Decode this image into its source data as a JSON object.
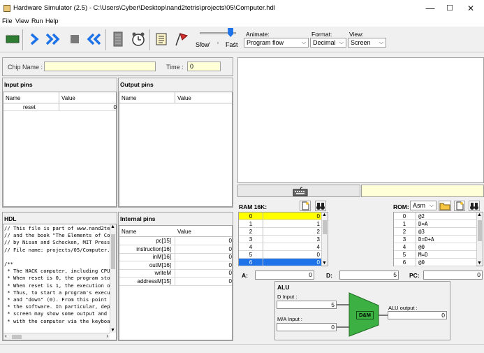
{
  "window": {
    "title": "Hardware Simulator (2.5) - C:\\Users\\Cyber\\Desktop\\nand2tetris\\projects\\05\\Computer.hdl",
    "minimize": "—",
    "maximize": "☐",
    "close": "✕"
  },
  "menu": [
    "File",
    "View",
    "Run",
    "Help"
  ],
  "toolbar": {
    "speed_slow": "Slow",
    "speed_fast": "Fast",
    "speed_level": 0.85,
    "animate_label": "Animate:",
    "animate_value": "Program flow",
    "format_label": "Format:",
    "format_value": "Decimal",
    "view_label": "View:",
    "view_value": "Screen",
    "icons": [
      "load-chip-icon",
      "single-step-icon",
      "run-icon",
      "stop-icon",
      "reset-icon",
      "eval-icon",
      "clock-icon",
      "script-icon",
      "breakpoint-icon"
    ]
  },
  "chip": {
    "name_label": "Chip Name :",
    "name_value": "",
    "time_label": "Time :",
    "time_value": "0"
  },
  "input_pins": {
    "title": "Input pins",
    "headers": [
      "Name",
      "Value"
    ],
    "rows": [
      {
        "name": "reset",
        "value": "0"
      }
    ]
  },
  "output_pins": {
    "title": "Output pins",
    "headers": [
      "Name",
      "Value"
    ]
  },
  "hdl": {
    "title": "HDL",
    "lines": [
      "// This file is part of www.nand2tetr",
      "// and the book \"The Elements of Comp",
      "// by Nisan and Schocken, MIT Press.",
      "// File name: projects/05/Computer.hd",
      "",
      "/**",
      " * The HACK computer, including CPU, ",
      " * When reset is 0, the program store",
      " * When reset is 1, the execution of ",
      " * Thus, to start a program's executi",
      " * and \"down\" (0). From this point on",
      " * the software. In particular, depen",
      " * screen may show some output and th",
      " * with the computer via the keyboard"
    ]
  },
  "internal_pins": {
    "title": "Internal pins",
    "headers": [
      "Name",
      "Value"
    ],
    "rows": [
      {
        "name": "pc[15]",
        "value": "0"
      },
      {
        "name": "instruction[16]",
        "value": "0"
      },
      {
        "name": "inM[16]",
        "value": "0"
      },
      {
        "name": "outM[16]",
        "value": "0"
      },
      {
        "name": "writeM",
        "value": "0"
      },
      {
        "name": "addressM[15]",
        "value": "0"
      }
    ]
  },
  "ram": {
    "title": "RAM 16K:",
    "rows": [
      {
        "addr": "0",
        "value": "0"
      },
      {
        "addr": "1",
        "value": "1"
      },
      {
        "addr": "2",
        "value": "2"
      },
      {
        "addr": "3",
        "value": "3"
      },
      {
        "addr": "4",
        "value": "4"
      },
      {
        "addr": "5",
        "value": "0"
      },
      {
        "addr": "6",
        "value": "0"
      }
    ]
  },
  "rom": {
    "title": "ROM:",
    "format_value": "Asm",
    "rows": [
      {
        "addr": "0",
        "value": "@2"
      },
      {
        "addr": "1",
        "value": "D=A"
      },
      {
        "addr": "2",
        "value": "@3"
      },
      {
        "addr": "3",
        "value": "D=D+A"
      },
      {
        "addr": "4",
        "value": "@0"
      },
      {
        "addr": "5",
        "value": "M=D"
      },
      {
        "addr": "6",
        "value": "@0"
      }
    ]
  },
  "registers": {
    "a_label": "A:",
    "a_value": "0",
    "d_label": "D:",
    "d_value": "5",
    "pc_label": "PC:",
    "pc_value": "0"
  },
  "alu": {
    "title": "ALU",
    "d_input_label": "D Input :",
    "d_input_value": "5",
    "ma_input_label": "M/A Input :",
    "ma_input_value": "0",
    "op_label": "D&M",
    "output_label": "ALU output :",
    "output_value": "0"
  },
  "colors": {
    "accent_blue": "#1e73e8",
    "highlight_yellow": "#ffff00",
    "selection_blue": "#1e73e8",
    "alu_green": "#3cb043"
  }
}
